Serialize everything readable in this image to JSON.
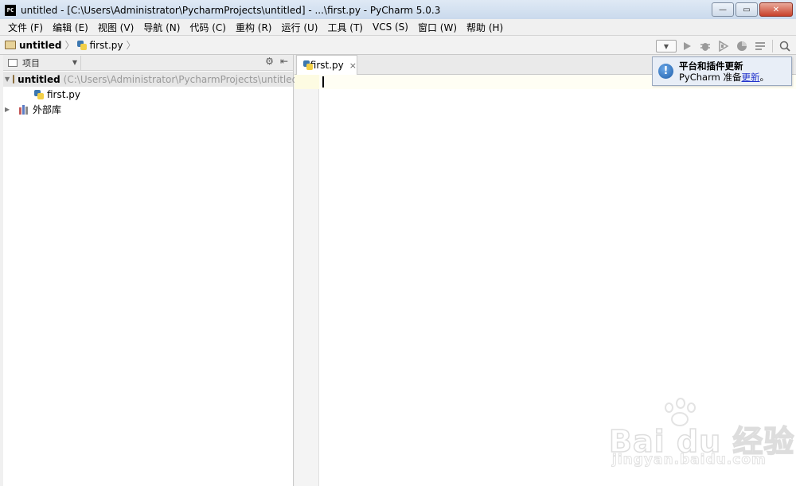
{
  "window": {
    "app_icon_text": "PC",
    "title": "untitled - [C:\\Users\\Administrator\\PycharmProjects\\untitled] - ...\\first.py - PyCharm 5.0.3",
    "buttons": {
      "minimize": "—",
      "maximize": "▭",
      "close": "✕"
    }
  },
  "menu": {
    "items": [
      {
        "label": "文件 (F)"
      },
      {
        "label": "编辑 (E)"
      },
      {
        "label": "视图 (V)"
      },
      {
        "label": "导航 (N)"
      },
      {
        "label": "代码 (C)"
      },
      {
        "label": "重构 (R)"
      },
      {
        "label": "运行 (U)"
      },
      {
        "label": "工具 (T)"
      },
      {
        "label": "VCS (S)"
      },
      {
        "label": "窗口 (W)"
      },
      {
        "label": "帮助 (H)"
      }
    ]
  },
  "navbar": {
    "project_crumb": "untitled",
    "file_crumb": "first.py",
    "separator": "〉",
    "toolbar_icons": [
      "run-config-dropdown",
      "run-icon",
      "debug-icon",
      "coverage-icon",
      "profile-icon",
      "stop-icon",
      "search-icon"
    ]
  },
  "project_panel": {
    "view_label": "项目",
    "root_name": "untitled",
    "root_path": "(C:\\Users\\Administrator\\PycharmProjects\\untitled)",
    "file_name": "first.py",
    "external_libraries": "外部库"
  },
  "editor": {
    "tab_label": "first.py",
    "tab_close": "×",
    "content": ""
  },
  "notification": {
    "title": "平台和插件更新",
    "body_prefix": "PyCharm 准备",
    "body_link": "更新",
    "body_suffix": "。"
  },
  "watermark": {
    "brand": "Bai du 经验",
    "domain": "jingyan.baidu.com"
  }
}
